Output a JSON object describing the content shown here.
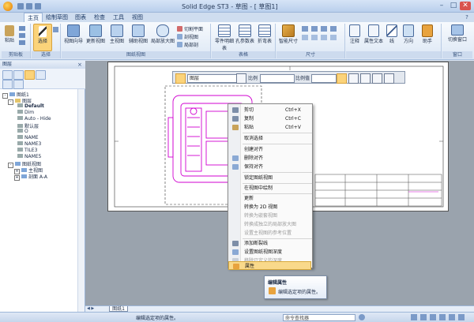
{
  "titlebar": {
    "title": "Solid Edge ST3 - 草图 - [ 草图1]",
    "min": "–",
    "max": "□",
    "close": "✕"
  },
  "menu": {
    "tabs": [
      "主页",
      "绘制草图",
      "图表",
      "检查",
      "工具",
      "视图"
    ],
    "active": "主页"
  },
  "ribbon": {
    "clipboard": {
      "paste": "粘贴",
      "label": "剪贴板"
    },
    "select": {
      "select": "选择",
      "label": "选择"
    },
    "views": {
      "view_wizard": "视图向导",
      "update_view": "更新视图",
      "principal_view": "主视图",
      "auxiliary_view": "辅助视图",
      "detail_view": "局部放大图",
      "cut_plane": "切割平面",
      "section_view": "剖视图",
      "broken_out": "局部剖",
      "label": "图纸视图"
    },
    "tables": {
      "parts_list": "零件明细表",
      "hole_table": "孔参数表",
      "bend_table": "折弯表",
      "label": "表格"
    },
    "dimension": {
      "smart_dim": "智能尺寸",
      "label": "尺寸"
    },
    "annotation": {
      "annotation": "注释",
      "property_text": "属性文本",
      "line": "线",
      "direction": "方向",
      "assistant": "助手",
      "label": ""
    },
    "window": {
      "switch_window": "切换窗口",
      "label": "窗口"
    }
  },
  "leftpanel": {
    "title": "图层",
    "tree": [
      {
        "text": "图纸1",
        "box": "-",
        "indent": 0
      },
      {
        "text": "图层",
        "box": "-",
        "indent": 1
      },
      {
        "text": "Default",
        "box": "",
        "indent": 2,
        "bold": true
      },
      {
        "text": "Dim",
        "box": "",
        "indent": 2
      },
      {
        "text": "Auto - Hide",
        "box": "",
        "indent": 2
      },
      {
        "text": "默认层",
        "box": "",
        "indent": 2
      },
      {
        "text": "O",
        "box": "",
        "indent": 2
      },
      {
        "text": "NAME",
        "box": "",
        "indent": 2
      },
      {
        "text": "NAME3",
        "box": "",
        "indent": 2
      },
      {
        "text": "TILE3",
        "box": "",
        "indent": 2
      },
      {
        "text": "NAME5",
        "box": "",
        "indent": 2
      },
      {
        "text": "图纸视图",
        "box": "-",
        "indent": 1
      },
      {
        "text": "主视图",
        "box": "+",
        "indent": 2
      },
      {
        "text": "剖面 A-A",
        "box": "+",
        "indent": 2
      }
    ]
  },
  "floattool": {
    "layer": "图层",
    "scale_label": "比例",
    "scale_value": "",
    "ratio_label": "比例值"
  },
  "context_menu": {
    "items": [
      {
        "label": "剪切",
        "shortcut": "Ctrl+X",
        "disabled": false
      },
      {
        "label": "复制",
        "shortcut": "Ctrl+C",
        "disabled": false
      },
      {
        "label": "粘贴",
        "shortcut": "Ctrl+V",
        "disabled": false
      },
      {
        "label": "取消选择",
        "shortcut": "",
        "disabled": false
      },
      {
        "label": "创建对齐",
        "shortcut": "",
        "disabled": false
      },
      {
        "label": "删除对齐",
        "shortcut": "",
        "disabled": false
      },
      {
        "label": "保持对齐",
        "shortcut": "",
        "disabled": false
      },
      {
        "label": "锁定图纸视图",
        "shortcut": "",
        "disabled": false
      },
      {
        "label": "在视图中绘制",
        "shortcut": "",
        "disabled": false
      },
      {
        "label": "更新",
        "shortcut": "",
        "disabled": false
      },
      {
        "label": "转换为 2D 视图",
        "shortcut": "",
        "disabled": false
      },
      {
        "label": "转换为嵌套视图",
        "shortcut": "",
        "disabled": true
      },
      {
        "label": "转换成独立的局部放大图",
        "shortcut": "",
        "disabled": true
      },
      {
        "label": "设置主视图的参考位置",
        "shortcut": "",
        "disabled": true
      },
      {
        "label": "添加断裂线",
        "shortcut": "",
        "disabled": false
      },
      {
        "label": "设置图纸视图深度",
        "shortcut": "",
        "disabled": false
      },
      {
        "label": "移除已定义的深度",
        "shortcut": "",
        "disabled": true
      },
      {
        "label": "属性",
        "shortcut": "",
        "disabled": false
      }
    ]
  },
  "tooltip": {
    "title": "编辑属性",
    "body": "编辑选定项的属性。"
  },
  "sheet_tabs": {
    "active": "图纸1"
  },
  "statusbar": {
    "message": "编辑选定项的属性。",
    "command_placeholder": "命令查找器"
  },
  "colors": {
    "accent": "#f0a030",
    "drawing": "#d000d0",
    "highlight": "#f9d98b"
  }
}
